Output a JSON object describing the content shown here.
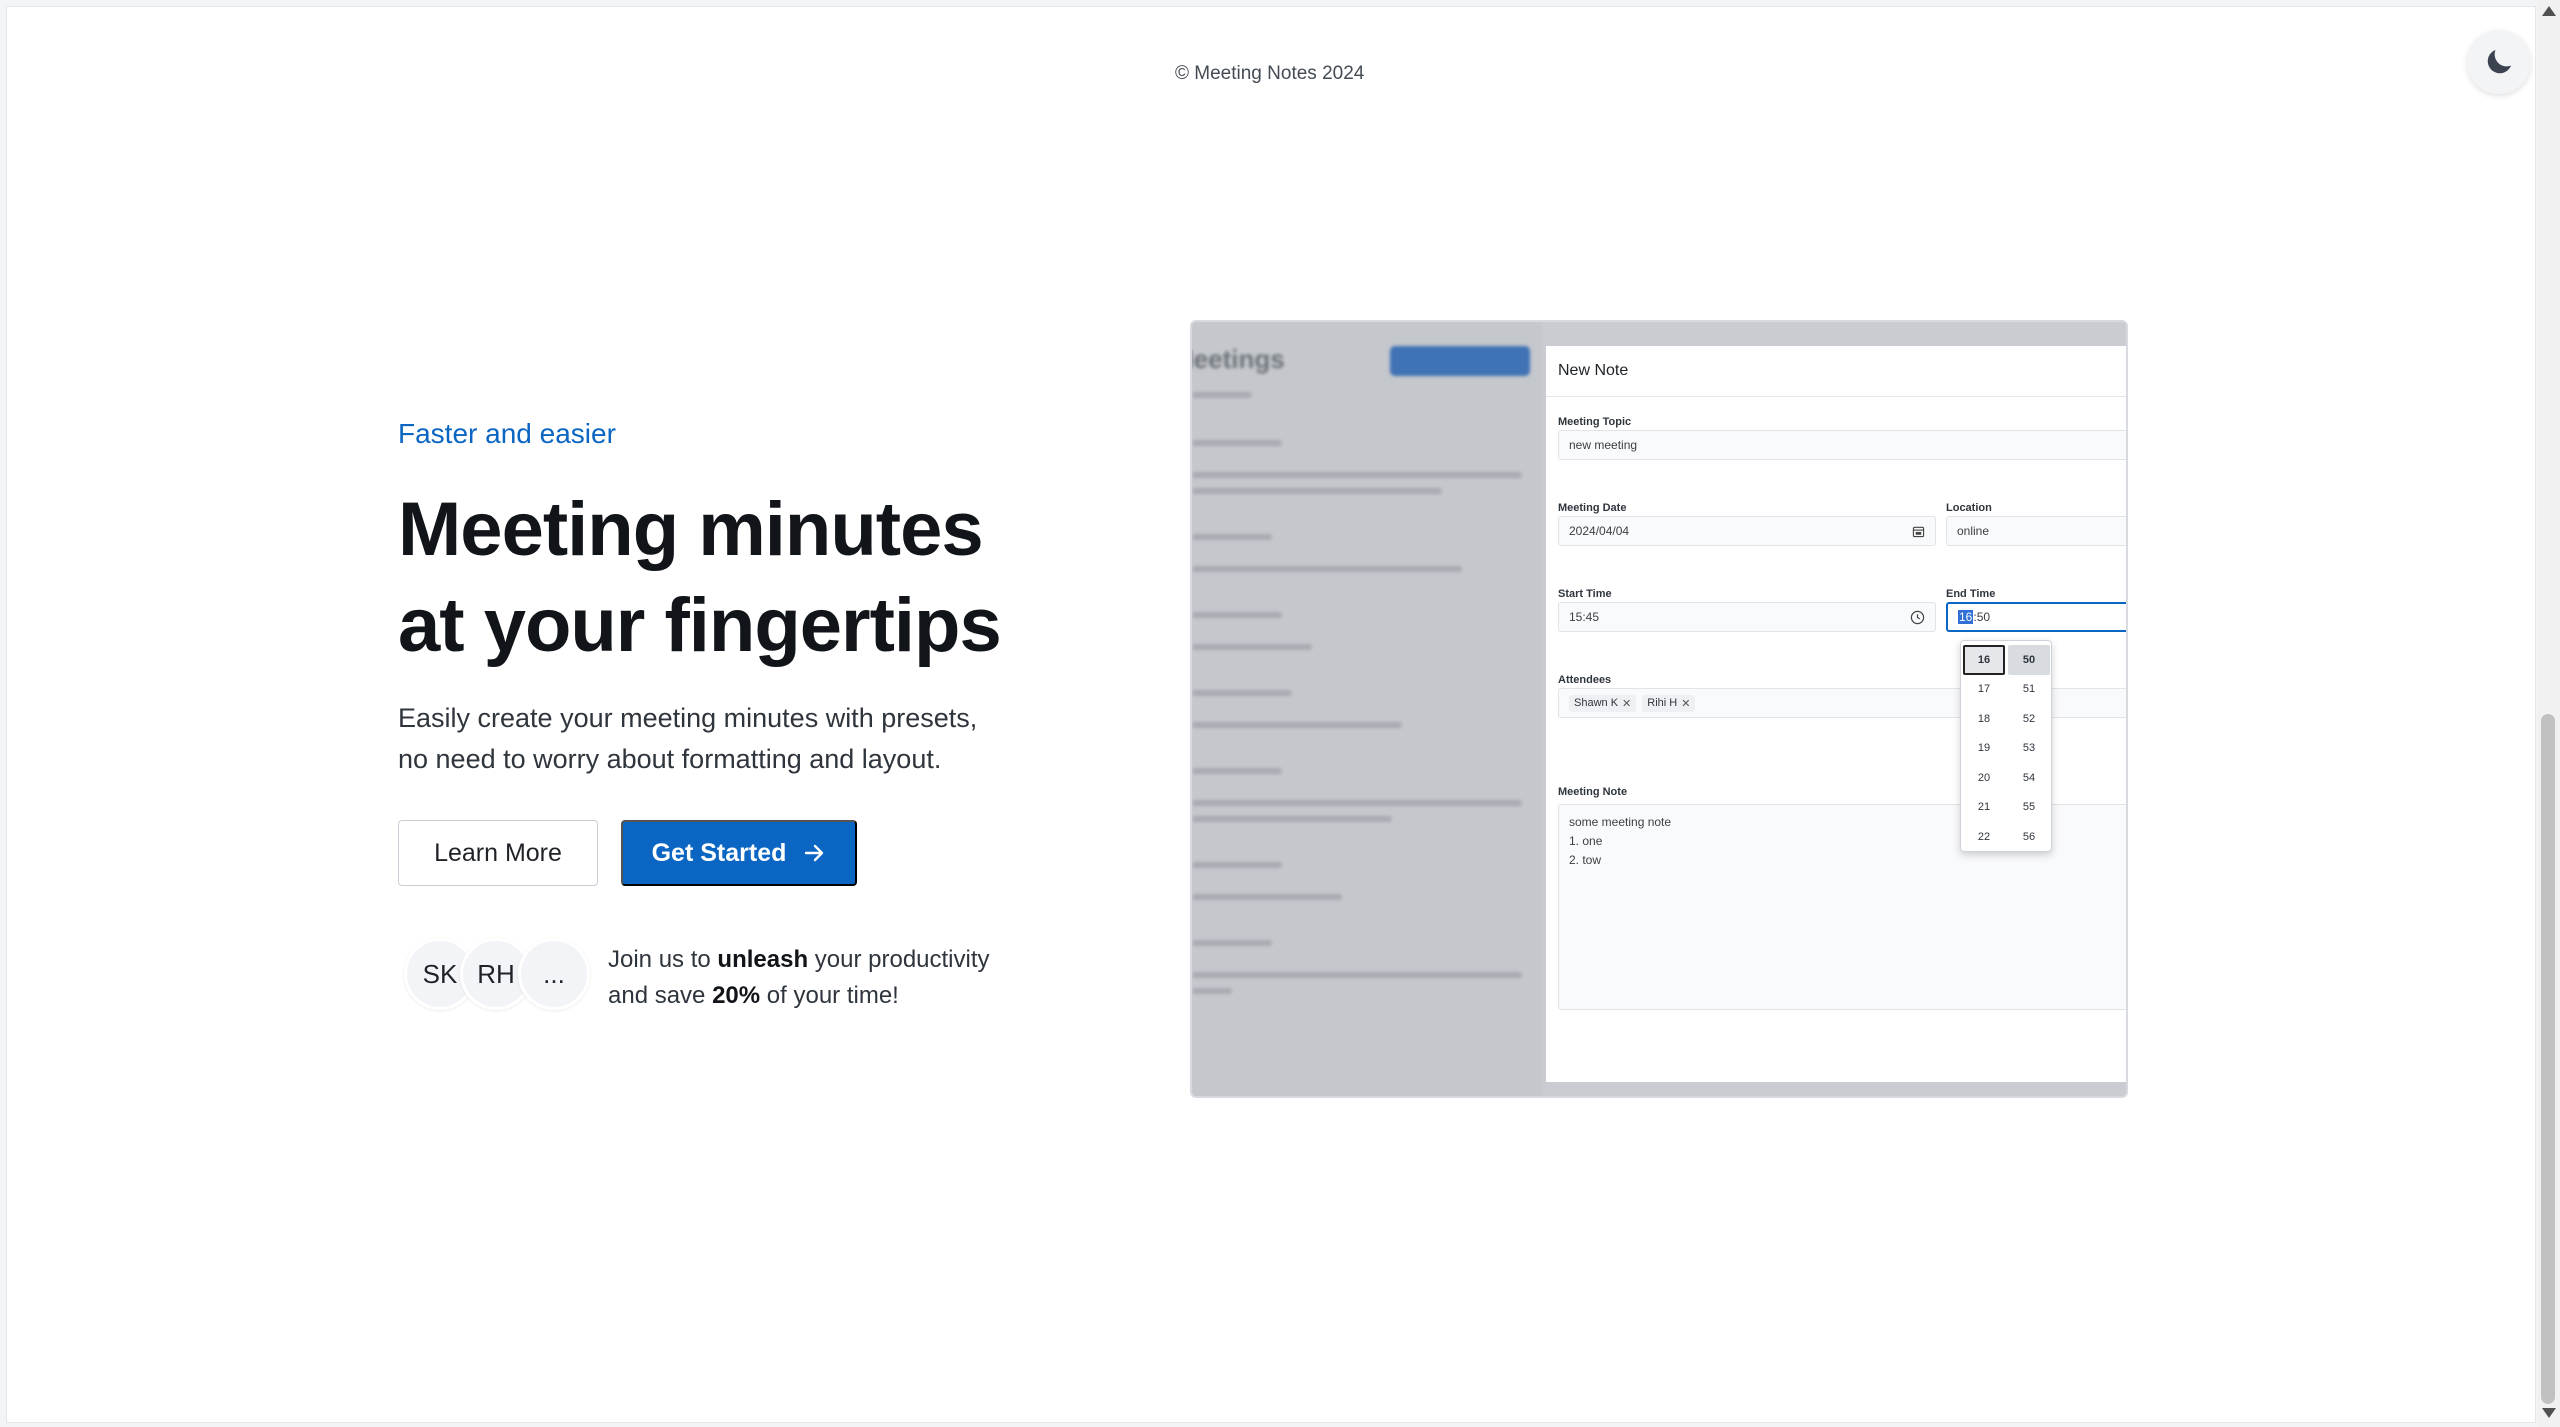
{
  "footer": {
    "copyright": "© Meeting Notes 2024"
  },
  "theme_toggle": {
    "icon": "moon-icon"
  },
  "hero": {
    "eyebrow": "Faster and easier",
    "title_line1": "Meeting minutes",
    "title_line2": "at your fingertips",
    "desc_line1": "Easily create your meeting minutes with presets,",
    "desc_line2": "no need to worry about formatting and layout.",
    "learn_more": "Learn More",
    "get_started": "Get Started"
  },
  "avatars": [
    "SK",
    "RH",
    "..."
  ],
  "join": {
    "p1": "Join us to ",
    "b1": "unleash",
    "p2": " your productivity",
    "p3": "and save ",
    "b2": "20%",
    "p4": " of your time!"
  },
  "preview": {
    "sidebar_title": "Meetings",
    "panel_title": "New Note",
    "topic_label": "Meeting Topic",
    "topic_value": "new meeting",
    "date_label": "Meeting Date",
    "date_value": "2024/04/04",
    "location_label": "Location",
    "location_value": "online",
    "start_label": "Start Time",
    "start_value": "15:45",
    "end_label": "End Time",
    "end_hour": "16",
    "end_rest": ":50",
    "attendees_label": "Attendees",
    "attendees": [
      "Shawn K",
      "Rihi H"
    ],
    "note_label": "Meeting Note",
    "note_lines": [
      "some meeting note",
      "1. one",
      "2. tow"
    ],
    "hours": [
      "16",
      "17",
      "18",
      "19",
      "20",
      "21",
      "22"
    ],
    "minutes": [
      "50",
      "51",
      "52",
      "53",
      "54",
      "55",
      "56"
    ]
  }
}
